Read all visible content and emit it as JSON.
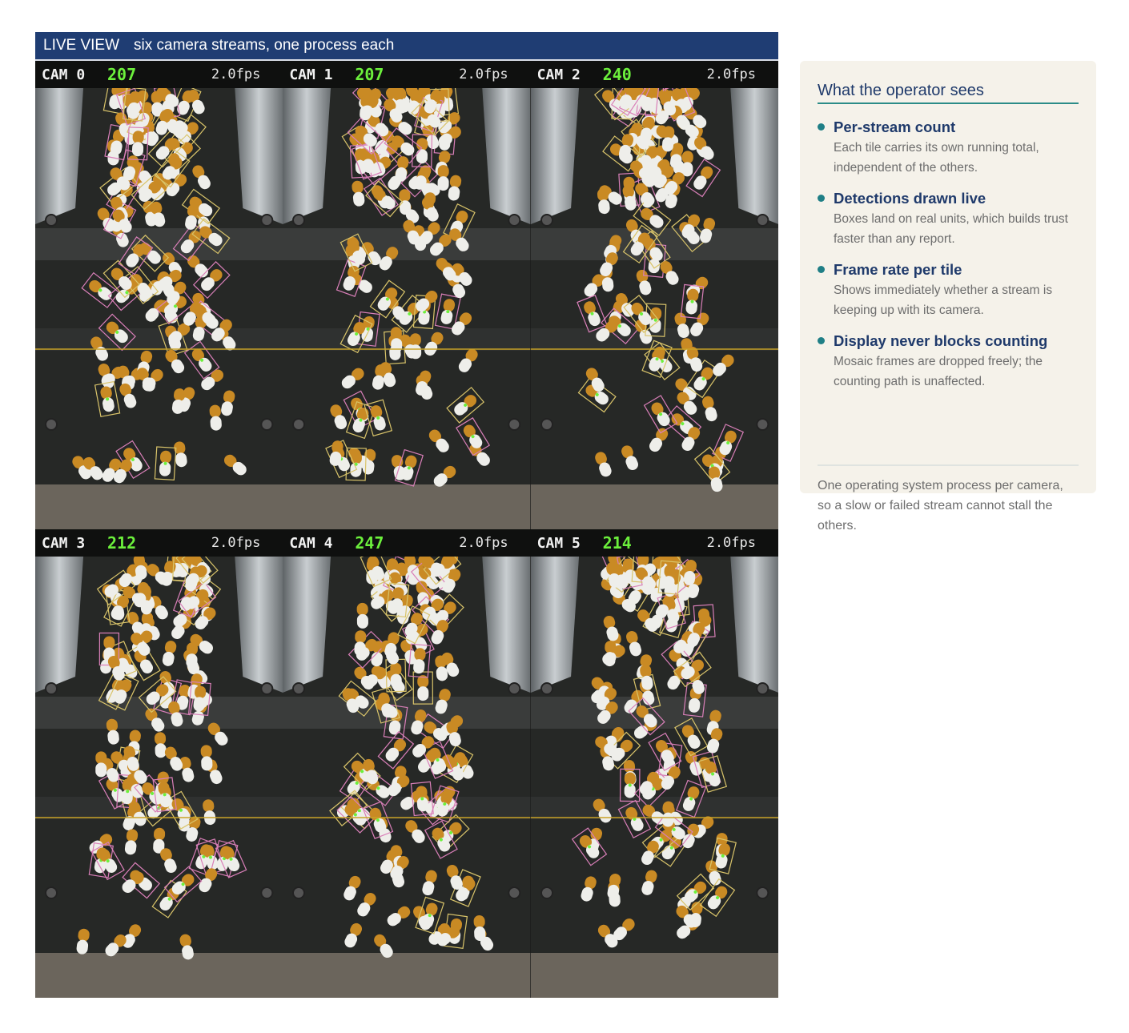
{
  "live_view": {
    "label": "LIVE VIEW",
    "subtitle": "six camera streams, one process each",
    "streams": [
      {
        "cam": "CAM 0",
        "count": "207",
        "fps": "2.0fps"
      },
      {
        "cam": "CAM 1",
        "count": "207",
        "fps": "2.0fps"
      },
      {
        "cam": "CAM 2",
        "count": "240",
        "fps": "2.0fps"
      },
      {
        "cam": "CAM 3",
        "count": "212",
        "fps": "2.0fps"
      },
      {
        "cam": "CAM 4",
        "count": "247",
        "fps": "2.0fps"
      },
      {
        "cam": "CAM 5",
        "count": "214",
        "fps": "2.0fps"
      }
    ]
  },
  "sidebar": {
    "title": "What the operator sees",
    "points": [
      {
        "title": "Per-stream count",
        "body": "Each tile carries its own running total, independent of the others."
      },
      {
        "title": "Detections drawn live",
        "body": "Boxes land on real units, which builds trust faster than any report."
      },
      {
        "title": "Frame rate per tile",
        "body": "Shows immediately whether a stream is keeping up with its camera."
      },
      {
        "title": "Display never blocks counting",
        "body": "Mosaic frames are dropped freely; the counting path is unaffected."
      }
    ],
    "footer": "One operating system process per camera, so a slow or failed stream cannot stall the others."
  },
  "colors": {
    "header_bg": "#1f3d73",
    "count_green": "#6cf03c",
    "accent_teal": "#2b8c88",
    "sidebar_bg": "#f5f2ea",
    "count_line": "#c9a227"
  }
}
